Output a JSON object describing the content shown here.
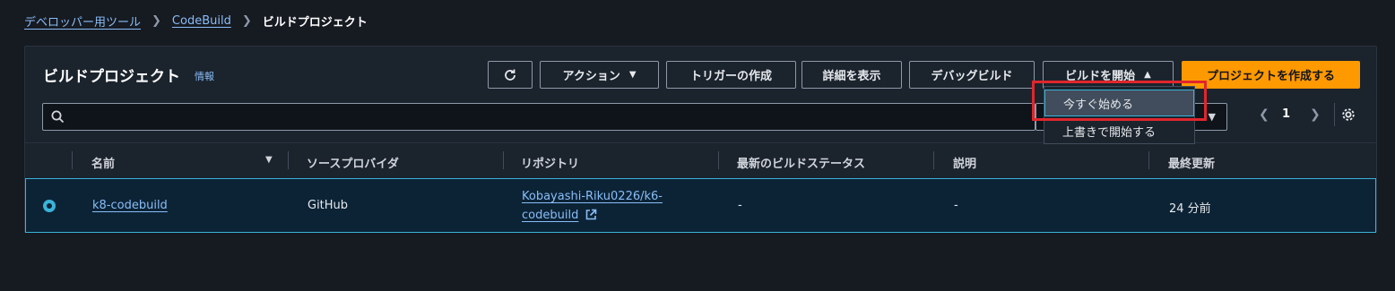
{
  "breadcrumb": {
    "item1": "デベロッパー用ツール",
    "item2": "CodeBuild",
    "current": "ビルドプロジェクト"
  },
  "panel": {
    "title": "ビルドプロジェクト",
    "info": "情報"
  },
  "toolbar": {
    "refresh_icon": "refresh-icon",
    "actions": "アクション",
    "create_trigger": "トリガーの作成",
    "view_details": "詳細を表示",
    "debug_build": "デバッグビルド",
    "start_build": "ビルドを開始",
    "create_project": "プロジェクトを作成する"
  },
  "search": {
    "placeholder": "",
    "value": ""
  },
  "pagination": {
    "page": "1",
    "prev_icon": "chevron-left-icon",
    "next_icon": "chevron-right-icon"
  },
  "settings_icon": "gear-icon",
  "table": {
    "columns": [
      "名前",
      "ソースプロバイダ",
      "リポジトリ",
      "最新のビルドステータス",
      "説明",
      "最終更新"
    ],
    "rows": [
      {
        "name": "k8-codebuild",
        "source": "GitHub",
        "repo_line1": "Kobayashi-Riku0226/k6-",
        "repo_line2": "codebuild",
        "status": "-",
        "description": "-",
        "updated": "24 分前"
      }
    ]
  },
  "start_menu": {
    "items": [
      "今すぐ始める",
      "上書きで開始する"
    ]
  },
  "colors": {
    "accent": "#ff9900",
    "link": "#89bdf7",
    "selection": "#3ab3d9",
    "annotation": "#e0262d",
    "background": "#161a21"
  }
}
